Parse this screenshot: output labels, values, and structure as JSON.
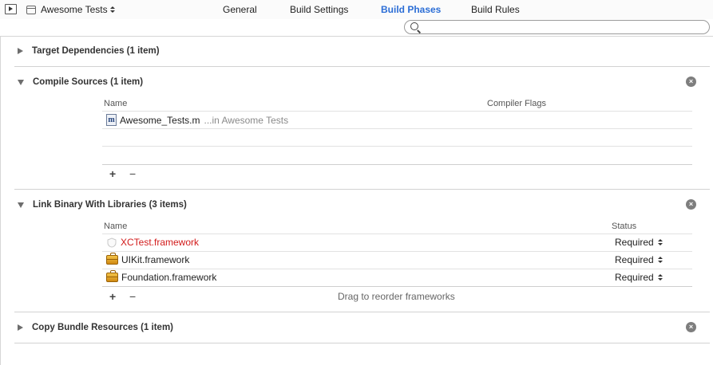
{
  "toolbar": {
    "target_name": "Awesome Tests",
    "tabs": [
      {
        "label": "General"
      },
      {
        "label": "Build Settings"
      },
      {
        "label": "Build Phases"
      },
      {
        "label": "Build Rules"
      }
    ],
    "active_tab": "Build Phases"
  },
  "search": {
    "placeholder": "",
    "value": ""
  },
  "phases": {
    "target_dependencies": {
      "title": "Target Dependencies (1 item)",
      "expanded": false
    },
    "compile_sources": {
      "title": "Compile Sources (1 item)",
      "expanded": true,
      "columns": {
        "name": "Name",
        "flags": "Compiler Flags"
      },
      "rows": [
        {
          "file": "Awesome_Tests.m",
          "location": "...in Awesome Tests",
          "flags": ""
        }
      ]
    },
    "link_binary": {
      "title": "Link Binary With Libraries (3 items)",
      "expanded": true,
      "columns": {
        "name": "Name",
        "status": "Status"
      },
      "rows": [
        {
          "name": "XCTest.framework",
          "status": "Required",
          "missing": true
        },
        {
          "name": "UIKit.framework",
          "status": "Required",
          "missing": false
        },
        {
          "name": "Foundation.framework",
          "status": "Required",
          "missing": false
        }
      ],
      "hint": "Drag to reorder frameworks"
    },
    "copy_bundle": {
      "title": "Copy Bundle Resources (1 item)",
      "expanded": false
    }
  },
  "controls": {
    "add": "+",
    "remove": "−",
    "close": "×"
  },
  "colors": {
    "active_tab": "#2c6ed6",
    "missing_item": "#d21b1b"
  }
}
